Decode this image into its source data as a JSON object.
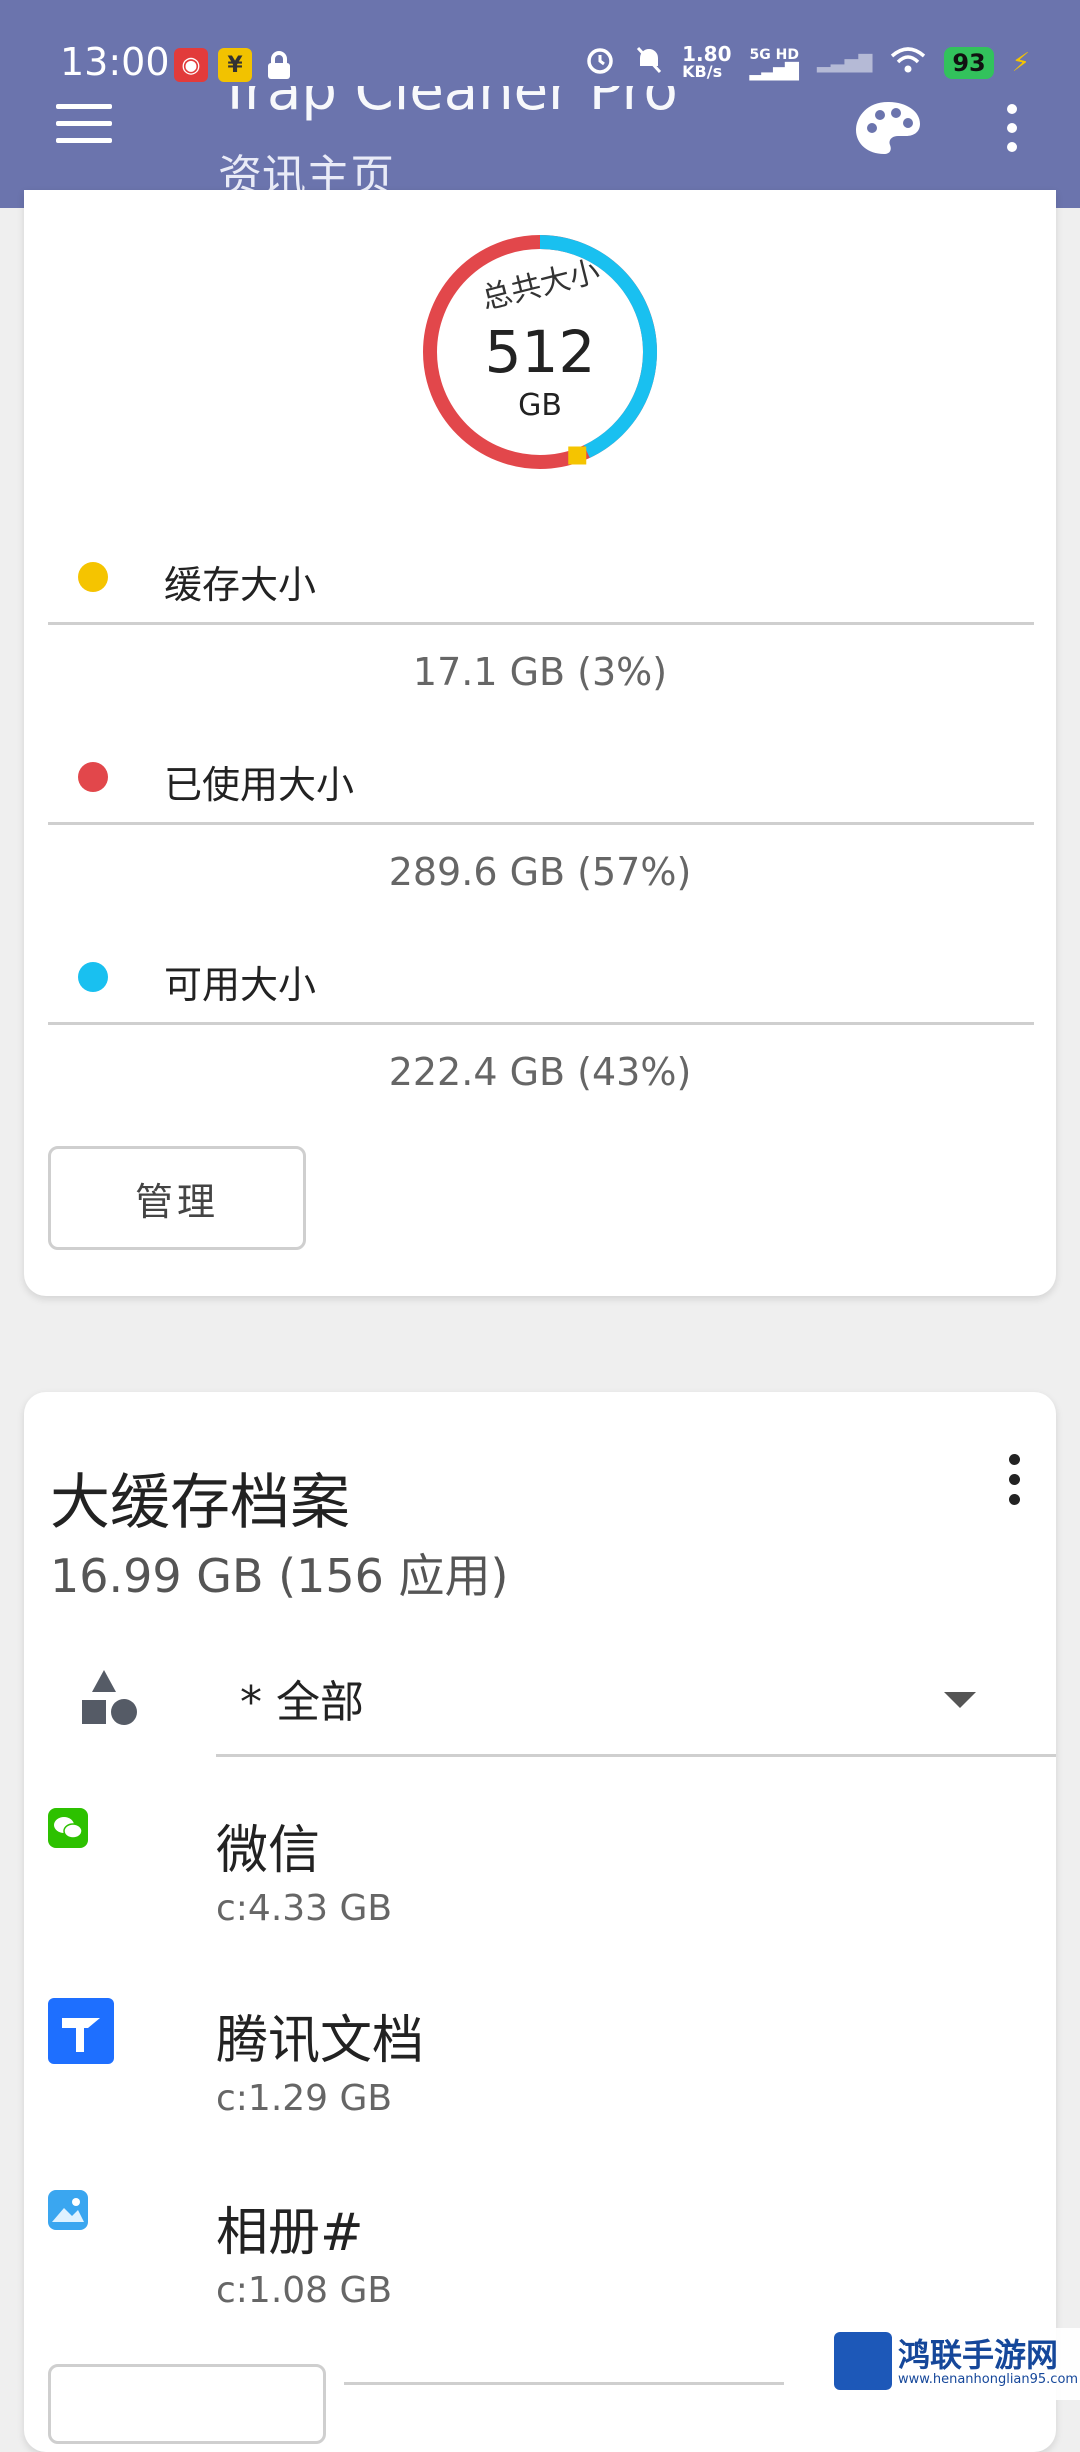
{
  "status_bar": {
    "time": "13:00",
    "net_speed": "1.80",
    "net_unit": "KB/s",
    "network": "5G HD",
    "battery": "93"
  },
  "appbar": {
    "title": "Trap Cleaner Pro",
    "subtitle": "资讯主页"
  },
  "storage": {
    "total_label": "总共大小",
    "total_value": "512",
    "total_unit": "GB",
    "rows": [
      {
        "label": "缓存大小",
        "value": "17.1 GB (3%)",
        "color": "#f5c400",
        "percent": 3
      },
      {
        "label": "已使用大小",
        "value": "289.6 GB (57%)",
        "color": "#e2474b",
        "percent": 57
      },
      {
        "label": "可用大小",
        "value": "222.4 GB (43%)",
        "color": "#19c0f0",
        "percent": 43
      }
    ],
    "manage_label": "管理"
  },
  "cache": {
    "title": "大缓存档案",
    "subtitle": "16.99 GB (156 应用)",
    "filter_value": "* 全部",
    "apps": [
      {
        "name": "微信",
        "size": "c:4.33 GB"
      },
      {
        "name": "腾讯文档",
        "size": "c:1.29 GB"
      },
      {
        "name": "相册#",
        "size": "c:1.08 GB"
      }
    ]
  },
  "watermark": {
    "text": "鸿联手游网",
    "url": "www.henanhonglian95.com"
  }
}
